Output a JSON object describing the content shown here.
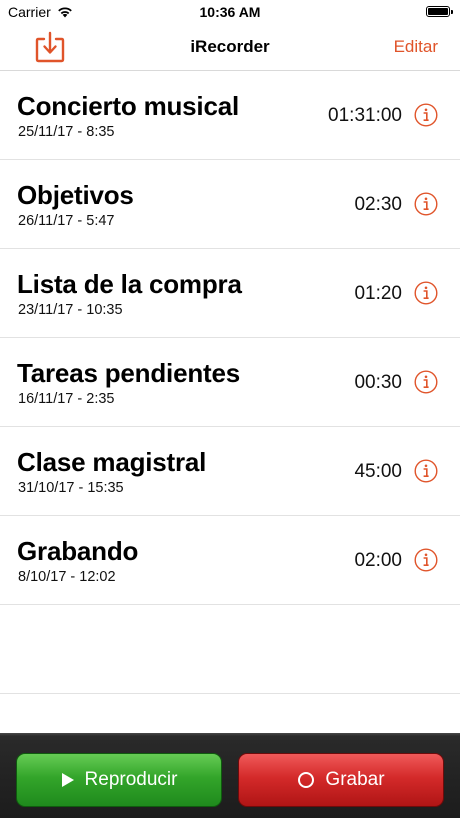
{
  "status_bar": {
    "carrier": "Carrier",
    "time": "10:36 AM"
  },
  "nav": {
    "title": "iRecorder",
    "left_icon": "download-tray-icon",
    "edit_label": "Editar",
    "accent_color": "#e0542a"
  },
  "recordings": [
    {
      "title": "Concierto musical",
      "date": "25/11/17 - 8:35",
      "duration": "01:31:00"
    },
    {
      "title": "Objetivos",
      "date": "26/11/17 - 5:47",
      "duration": "02:30"
    },
    {
      "title": "Lista de la compra",
      "date": "23/11/17 - 10:35",
      "duration": "01:20"
    },
    {
      "title": "Tareas pendientes",
      "date": "16/11/17 - 2:35",
      "duration": "00:30"
    },
    {
      "title": "Clase magistral",
      "date": "31/10/17 - 15:35",
      "duration": "45:00"
    },
    {
      "title": "Grabando",
      "date": "8/10/17 - 12:02",
      "duration": "02:00"
    }
  ],
  "toolbar": {
    "play_label": "Reproducir",
    "record_label": "Grabar",
    "play_color": "#2e9e27",
    "record_color": "#d12828"
  }
}
